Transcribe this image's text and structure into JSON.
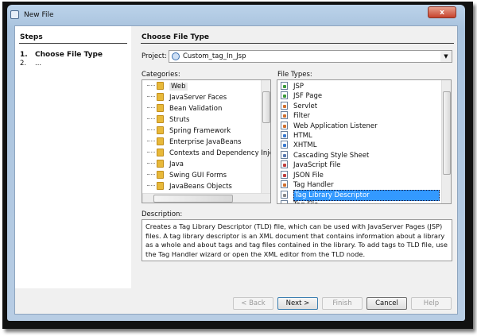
{
  "window": {
    "title": "New File",
    "close_label": "x"
  },
  "steps": {
    "heading": "Steps",
    "items": [
      {
        "num": "1.",
        "label": "Choose File Type"
      },
      {
        "num": "2.",
        "label": "..."
      }
    ]
  },
  "main": {
    "heading": "Choose File Type",
    "project_label": "Project:",
    "project_value": "Custom_tag_In_Jsp",
    "categories_label": "Categories:",
    "categories": [
      "Web",
      "JavaServer Faces",
      "Bean Validation",
      "Struts",
      "Spring Framework",
      "Enterprise JavaBeans",
      "Contexts and Dependency Inje",
      "Java",
      "Swing GUI Forms",
      "JavaBeans Objects"
    ],
    "file_types_label": "File Types:",
    "file_types": [
      "JSP",
      "JSF Page",
      "Servlet",
      "Filter",
      "Web Application Listener",
      "HTML",
      "XHTML",
      "Cascading Style Sheet",
      "JavaScript File",
      "JSON File",
      "Tag Handler",
      "Tag Library Descriptor",
      "Tag File"
    ],
    "selected_file_type": "Tag Library Descriptor",
    "description_label": "Description:",
    "description": "Creates a Tag Library Descriptor (TLD) file, which can be used with JavaServer Pages (JSP) files. A tag library descriptor is an XML document that contains information about a library as a whole and about tags and tag files contained in the library. To add tags to TLD file, use the Tag Handler wizard or open the XML editor from the TLD node."
  },
  "buttons": {
    "back": "< Back",
    "next": "Next >",
    "finish": "Finish",
    "cancel": "Cancel",
    "help": "Help"
  },
  "colors": {
    "selection": "#3399ff",
    "title_bar": "#b4cbe3"
  }
}
